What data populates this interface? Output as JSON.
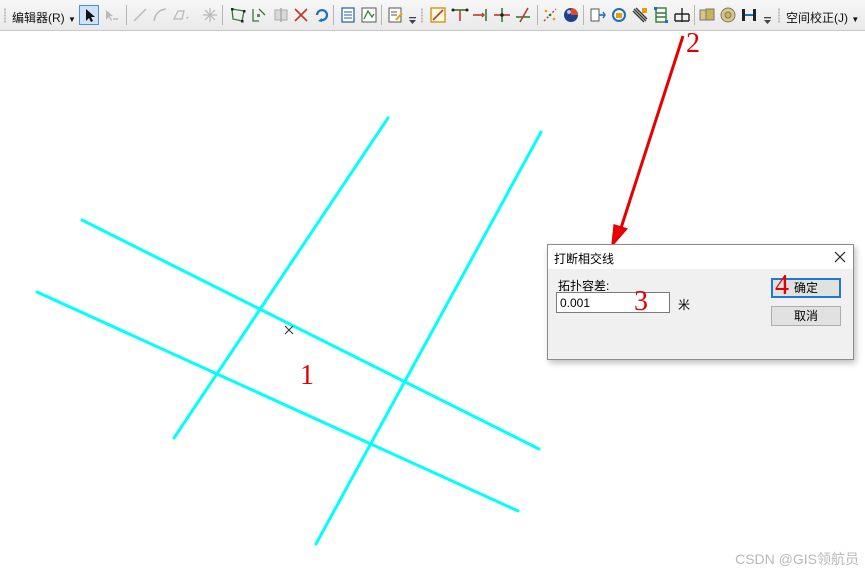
{
  "toolbar": {
    "editor_menu_label": "编辑器(R)",
    "spatial_adjust_label": "空间校正(J)",
    "accent_color": "#4d8fd1"
  },
  "canvas": {
    "line_color": "#00ffff",
    "annotations": {
      "label_1": "1",
      "label_2": "2",
      "label_3": "3",
      "label_4": "4",
      "color": "#e00000"
    }
  },
  "dialog": {
    "title": "打断相交线",
    "tolerance_label": "拓扑容差:",
    "tolerance_value": "0.001",
    "unit": "米",
    "ok_label": "确定",
    "cancel_label": "取消"
  },
  "watermark": "CSDN @GIS领航员"
}
